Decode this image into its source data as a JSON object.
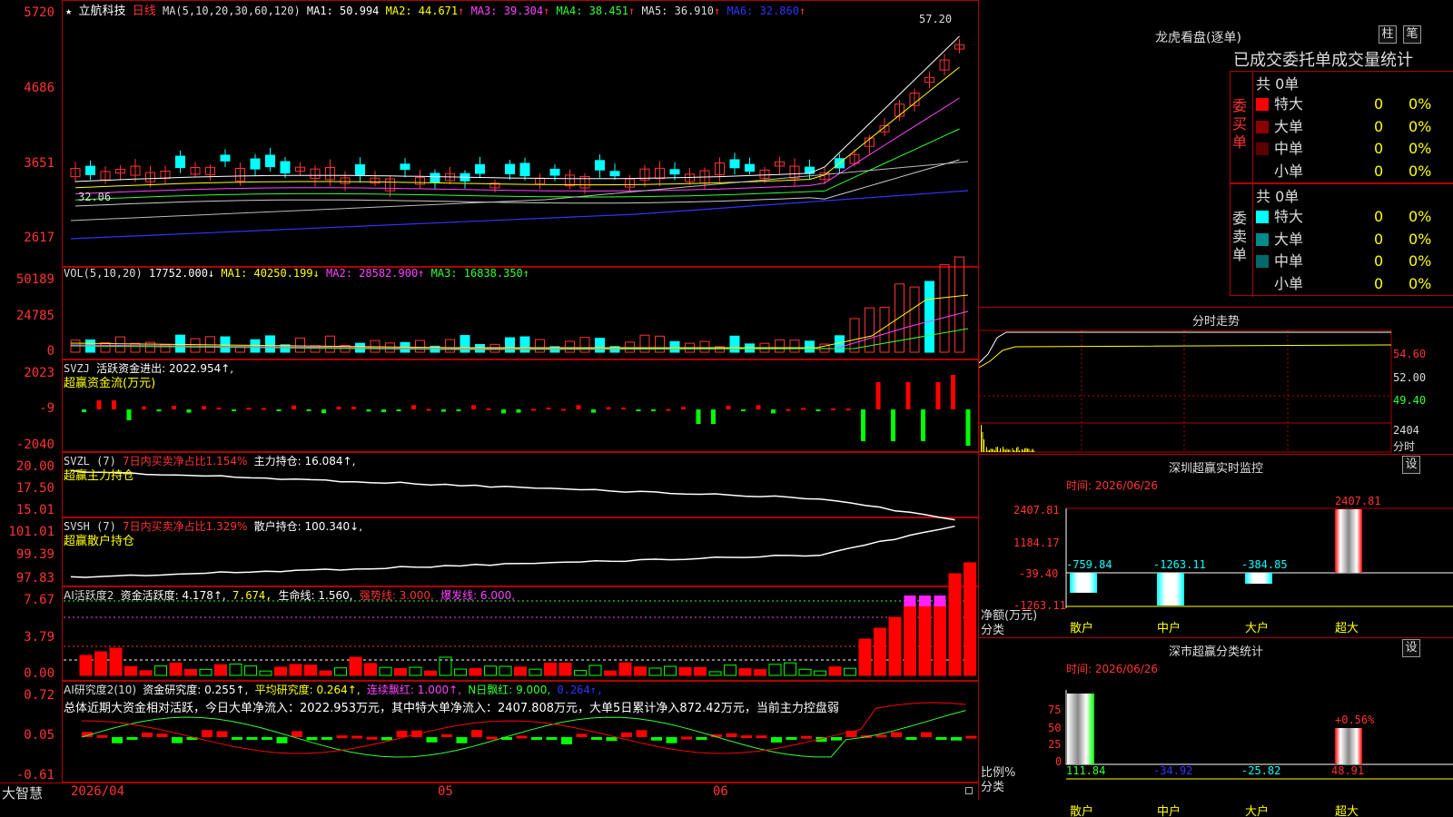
{
  "header": {
    "title": "立航科技",
    "period": "日线",
    "ma": "MA(5,10,20,30,60,120)",
    "ma1": "MA1: 50.994",
    "ma2": "MA2: 44.671",
    "ma3": "MA3: 39.304",
    "ma4": "MA4: 38.451",
    "ma5": "MA5: 36.910",
    "ma6": "MA6: 32.860",
    "up": "↑",
    "star": "★"
  },
  "price_axis": [
    "5720",
    "4686",
    "3651",
    "2617"
  ],
  "price_marks": {
    "high": "57.20",
    "low": "32.06"
  },
  "vol": {
    "label": "VOL(5,10,20)",
    "v": "17752.000↓",
    "ma1": "MA1: 40250.199↓",
    "ma2": "MA2: 28582.900↑",
    "ma3": "MA3: 16838.350↑",
    "axis": [
      "50189",
      "24785",
      "0"
    ]
  },
  "svzj": {
    "label": "SVZJ",
    "text": "活跃资金进出: 2022.954↑,",
    "sub": "超赢资金流(万元)",
    "axis": [
      "2023",
      "-9",
      "-2040"
    ]
  },
  "svzl": {
    "label": "SVZL (7)",
    "t1": "7日内买卖净占比1.154%",
    "t2": "主力持仓: 16.084↑,",
    "sub": "超赢主力持仓",
    "axis": [
      "20.00",
      "17.50",
      "15.01"
    ]
  },
  "svsh": {
    "label": "SVSH (7)",
    "t1": "7日内买卖净占比1.329%",
    "t2": "散户持仓: 100.340↓,",
    "sub": "超赢散户持仓",
    "axis": [
      "101.01",
      "99.39",
      "97.83"
    ]
  },
  "ai1": {
    "label": "AI活跃度2",
    "t1": "资金活跃度: 4.178↑,",
    "t2": "7.674,",
    "t3": "生命线: 1.560,",
    "t4": "强势线: 3.000,",
    "t5": "爆发线: 6.000,",
    "axis": [
      "7.67",
      "3.79",
      "0.00"
    ]
  },
  "ai2": {
    "label": "AI研究度2(10)",
    "t1": "资金研究度: 0.255↑,",
    "t2": "平均研究度: 0.264↑,",
    "t3": "连续飘红: 1.000↑,",
    "t4": "N日飘红: 9.000,",
    "t5": "0.264↑,",
    "summary": "总体近期大资金相对活跃，今日大单净流入：2022.953万元，其中特大单净流入：2407.808万元，大单5日累计净入872.42万元，当前主力控盘弱",
    "axis": [
      "0.72",
      "0.05",
      "-0.61"
    ]
  },
  "date_axis": {
    "d1": "2026/04",
    "d2": "05",
    "d3": "06"
  },
  "brand": "大智慧",
  "right": {
    "lhkp": "龙虎看盘(逐单)",
    "btn_zhu": "柱",
    "btn_bi": "笔",
    "tab_strip": "已成交委托单成交量统计",
    "buy_label": "委买单",
    "sell_label": "委卖单",
    "buy_total": "共 0单",
    "sell_total": "共 0单",
    "buy_rows": [
      {
        "name": "特大",
        "v": "0",
        "p": "0%",
        "c": "#ff0000"
      },
      {
        "name": "大单",
        "v": "0",
        "p": "0%",
        "c": "#8b0000"
      },
      {
        "name": "中单",
        "v": "0",
        "p": "0%",
        "c": "#5a0000"
      },
      {
        "name": "小单",
        "v": "0",
        "p": "0%",
        "c": "#000000"
      }
    ],
    "sell_rows": [
      {
        "name": "特大",
        "v": "0",
        "p": "0%",
        "c": "#00ffff"
      },
      {
        "name": "大单",
        "v": "0",
        "p": "0%",
        "c": "#008b8b"
      },
      {
        "name": "中单",
        "v": "0",
        "p": "0%",
        "c": "#006a6a"
      },
      {
        "name": "小单",
        "v": "0",
        "p": "0%",
        "c": "#000000"
      }
    ],
    "fs_title": "分时走势",
    "fs_axis": [
      "54.60",
      "52.00",
      "49.40"
    ],
    "fs_vol": "2404",
    "fs_label": "分时",
    "sz_title": "深圳超赢实时监控",
    "sz_btn": "设",
    "sz_date": "时间: 2026/06/26",
    "sz_axis": [
      "2407.81",
      "1184.17",
      "-39.40",
      "-1263.11"
    ],
    "sz_ylabel": "净额(万元)",
    "sz_xlabel": "分类",
    "sz_top": "2407.81",
    "cats": [
      "散户",
      "中户",
      "大户",
      "超大"
    ],
    "sz_vals": [
      "-759.84",
      "-1263.11",
      "-384.85",
      "2407.81"
    ],
    "ss_title": "深市超赢分类统计",
    "ss_btn": "设",
    "ss_date": "时间: 2026/06/26",
    "ss_axis": [
      "75",
      "50",
      "25",
      "0"
    ],
    "ss_ylabel": "比例%",
    "ss_xlabel": "分类",
    "ss_pct": "+0.56%",
    "ss_vals": [
      "111.84",
      "-34.92",
      "-25.82",
      "48.91"
    ]
  }
}
